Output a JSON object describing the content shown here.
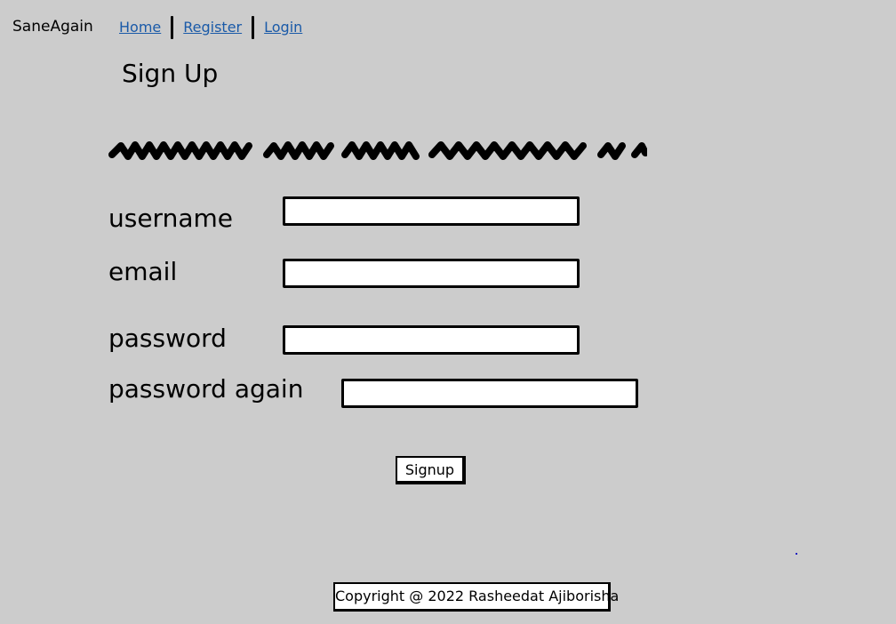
{
  "header": {
    "brand": "SaneAgain",
    "nav": [
      {
        "label": "Home"
      },
      {
        "label": "Register"
      },
      {
        "label": "Login"
      }
    ]
  },
  "main": {
    "title": "Sign Up",
    "form": {
      "username_label": "username",
      "username_value": "",
      "email_label": "email",
      "email_value": "",
      "password_label": "password",
      "password_value": "",
      "password_again_label": "password again",
      "password_again_value": "",
      "submit_label": "Signup"
    }
  },
  "footer": {
    "copyright": "Copyright @ 2022 Rasheedat Ajiborisha"
  }
}
